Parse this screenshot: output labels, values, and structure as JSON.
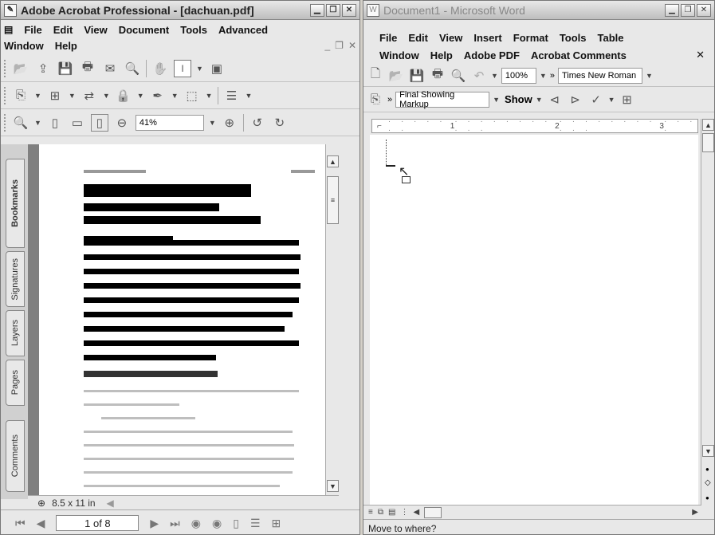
{
  "acrobat": {
    "title": "Adobe Acrobat Professional - [dachuan.pdf]",
    "menus_row1": [
      "File",
      "Edit",
      "View",
      "Document",
      "Tools",
      "Advanced"
    ],
    "menus_row2": [
      "Window",
      "Help"
    ],
    "zoom": "41%",
    "nav_tabs": [
      "Bookmarks",
      "Signatures",
      "Layers",
      "Pages",
      "Comments"
    ],
    "page_size": "8.5 x 11 in",
    "page_indicator": "1 of 8"
  },
  "word": {
    "title": "Document1 - Microsoft Word",
    "menus_row1": [
      "File",
      "Edit",
      "View",
      "Insert",
      "Format",
      "Tools",
      "Table"
    ],
    "menus_row2": [
      "Window",
      "Help",
      "Adobe PDF",
      "Acrobat Comments"
    ],
    "zoom": "100%",
    "font": "Times New Roman",
    "markup_mode": "Final Showing Markup",
    "show_label": "Show",
    "ruler_marks": [
      "1",
      "2",
      "3"
    ],
    "status": "Move to where?"
  }
}
